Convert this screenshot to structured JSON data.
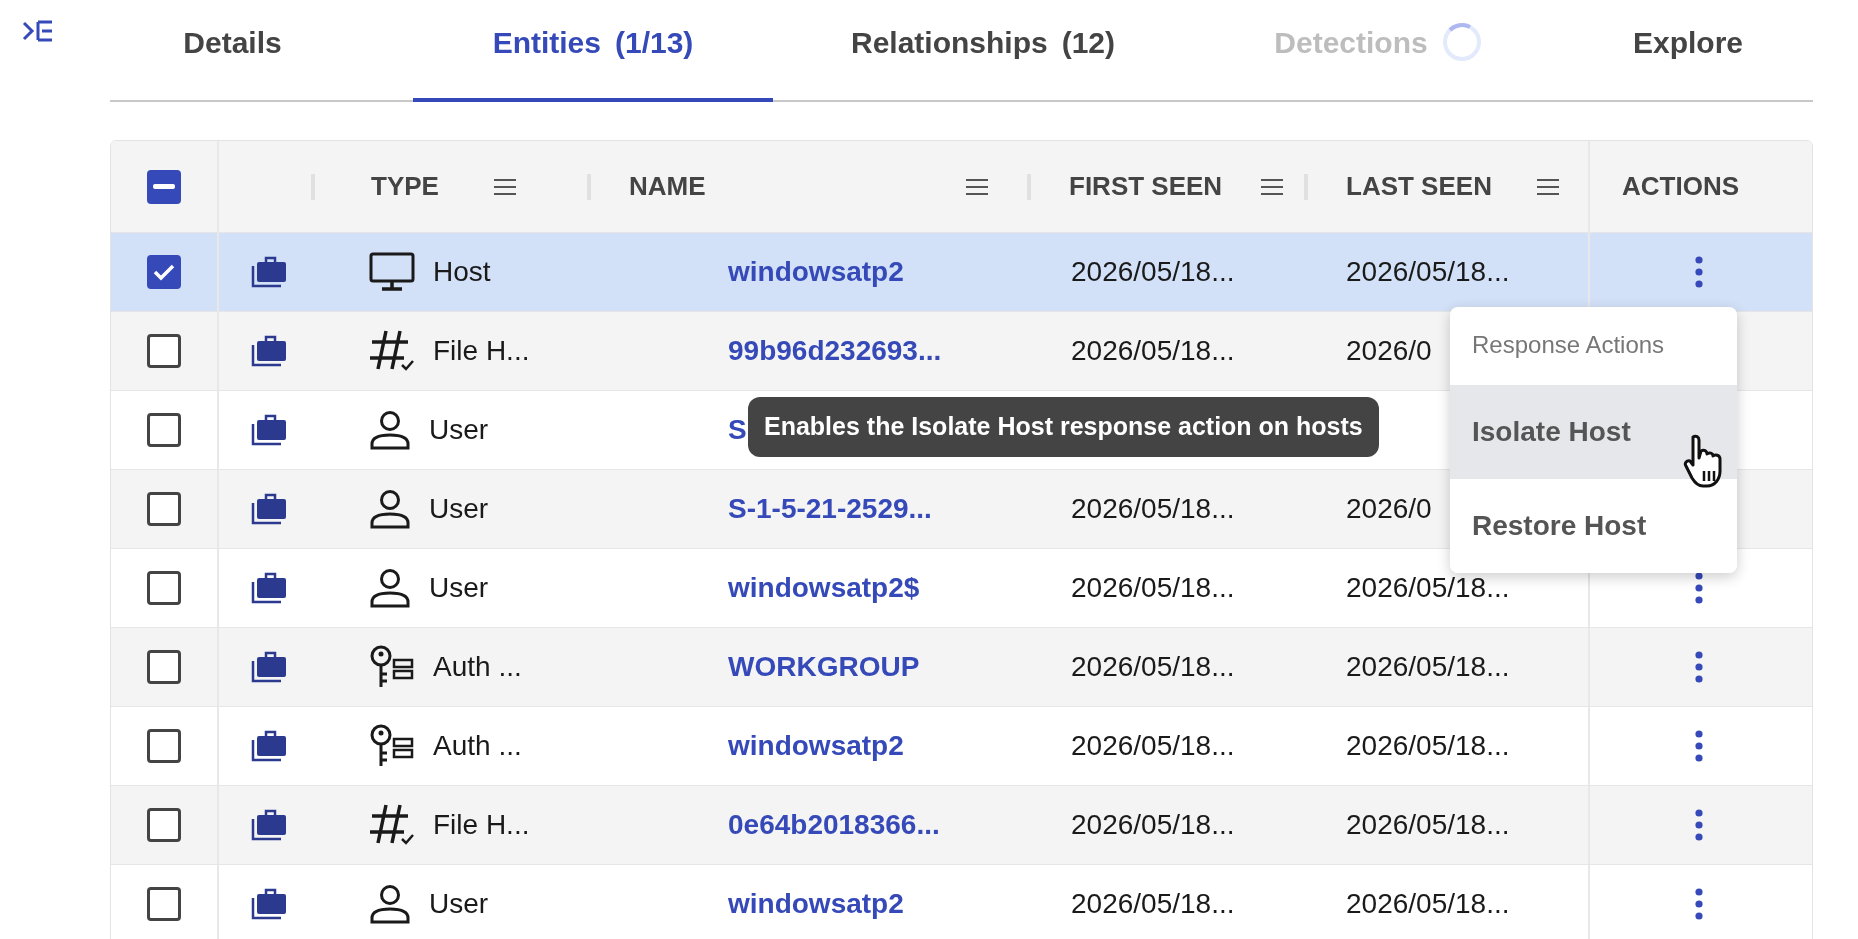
{
  "tabs": [
    {
      "label": "Details",
      "selected": false
    },
    {
      "label": "Entities",
      "count": "(1/13)",
      "selected": true
    },
    {
      "label": "Relationships",
      "count": "(12)",
      "selected": false
    },
    {
      "label": "Detections",
      "selected": false,
      "disabled": true,
      "loading": true
    },
    {
      "label": "Explore",
      "selected": false
    }
  ],
  "table": {
    "select_all": {
      "indeterminate": true
    },
    "columns": [
      {
        "label": "TYPE",
        "menu": true
      },
      {
        "label": "NAME",
        "menu": true
      },
      {
        "label": "FIRST SEEN",
        "menu": true
      },
      {
        "label": "LAST SEEN",
        "menu": true
      },
      {
        "label": "ACTIONS",
        "menu": false
      }
    ],
    "rows": [
      {
        "checked": true,
        "kind": "host",
        "type": "Host",
        "name": "windowsatp2",
        "first_seen": "2026/05/18...",
        "last_seen": "2026/05/18...",
        "actions_button": true
      },
      {
        "checked": false,
        "kind": "file_hash",
        "type": "File H...",
        "name": "99b96d232693...",
        "first_seen": "2026/05/18...",
        "last_seen": "2026/0"
      },
      {
        "checked": false,
        "kind": "user",
        "type": "User",
        "name": "S"
      },
      {
        "checked": false,
        "kind": "user",
        "type": "User",
        "name": "S-1-5-21-2529...",
        "first_seen": "2026/05/18...",
        "last_seen": "2026/0"
      },
      {
        "checked": false,
        "kind": "user",
        "type": "User",
        "name": "windowsatp2$",
        "first_seen": "2026/05/18...",
        "last_seen": "2026/05/18...",
        "actions_button": true
      },
      {
        "checked": false,
        "kind": "auth",
        "type": "Auth ...",
        "name": "WORKGROUP",
        "first_seen": "2026/05/18...",
        "last_seen": "2026/05/18...",
        "actions_button": true
      },
      {
        "checked": false,
        "kind": "auth",
        "type": "Auth ...",
        "name": "windowsatp2",
        "first_seen": "2026/05/18...",
        "last_seen": "2026/05/18...",
        "actions_button": true
      },
      {
        "checked": false,
        "kind": "file_hash",
        "type": "File H...",
        "name": "0e64b2018366...",
        "first_seen": "2026/05/18...",
        "last_seen": "2026/05/18...",
        "actions_button": true
      },
      {
        "checked": false,
        "kind": "user",
        "type": "User",
        "name": "windowsatp2",
        "first_seen": "2026/05/18...",
        "last_seen": "2026/05/18...",
        "actions_button": true
      }
    ]
  },
  "tooltip": {
    "text": "Enables the Isolate Host response action on hosts"
  },
  "action_menu": {
    "header": "Response Actions",
    "items": [
      {
        "label": "Isolate Host",
        "hovered": true
      },
      {
        "label": "Restore Host",
        "hovered": false
      }
    ]
  }
}
